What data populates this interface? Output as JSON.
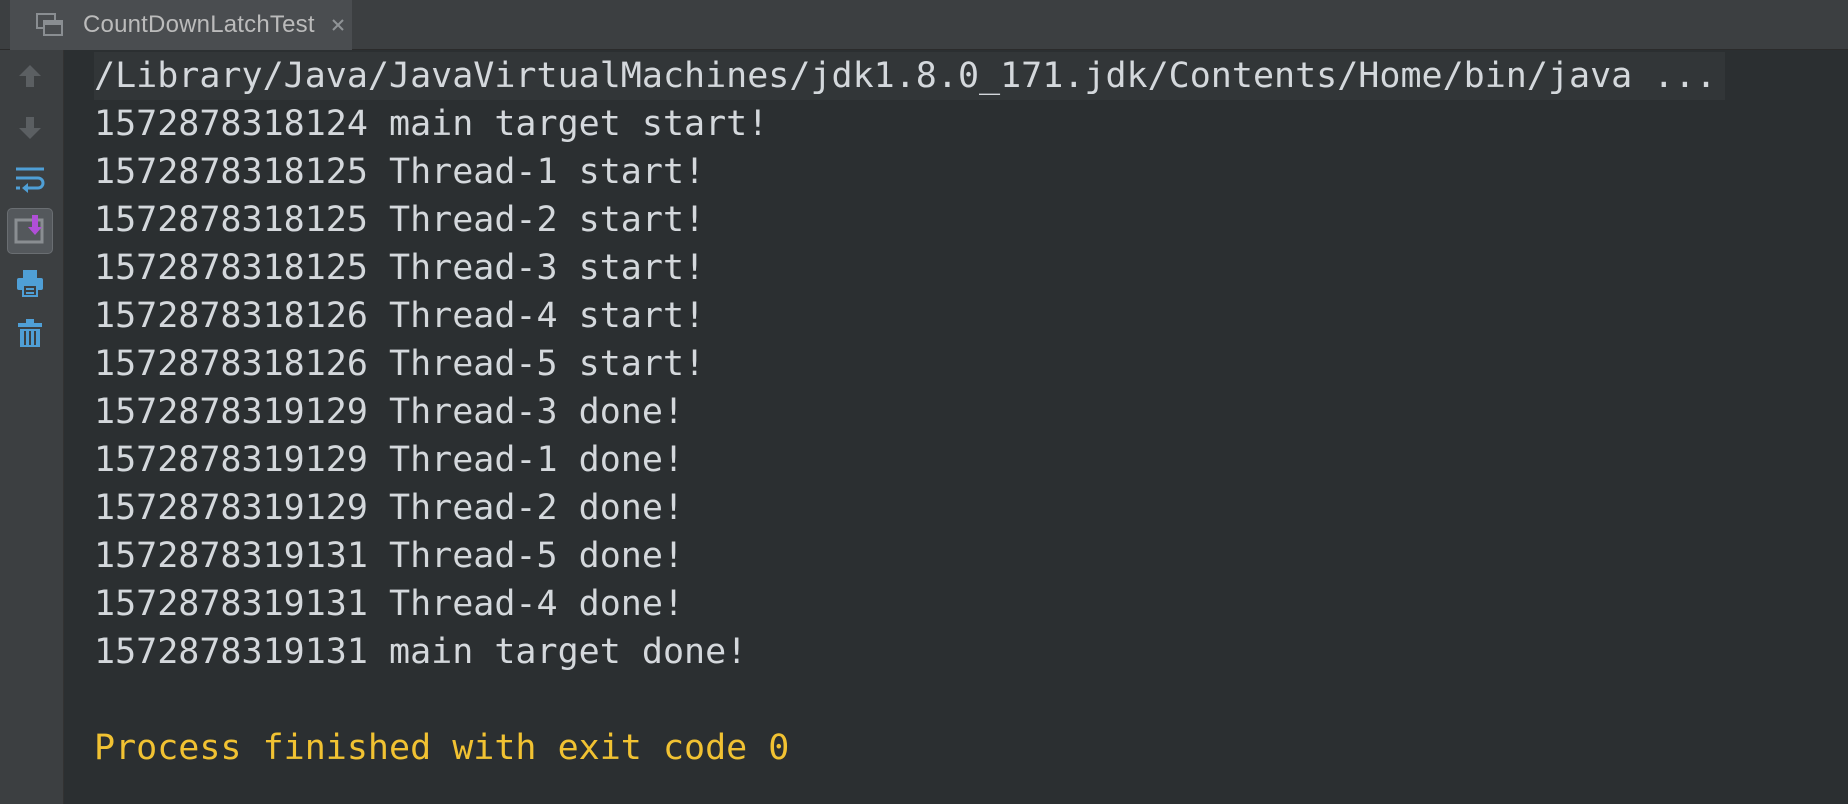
{
  "tab": {
    "title": "CountDownLatchTest",
    "icon": "console-window-icon",
    "close_icon": "close-icon"
  },
  "toolbar": {
    "items": [
      {
        "name": "scroll-up-arrow-icon"
      },
      {
        "name": "scroll-down-arrow-icon"
      },
      {
        "name": "soft-wrap-icon"
      },
      {
        "name": "scroll-to-end-icon",
        "active": true
      },
      {
        "name": "print-icon"
      },
      {
        "name": "clear-all-trash-icon"
      }
    ]
  },
  "console": {
    "command": "/Library/Java/JavaVirtualMachines/jdk1.8.0_171.jdk/Contents/Home/bin/java ...",
    "lines": [
      "1572878318124 main target start!",
      "1572878318125 Thread-1 start!",
      "1572878318125 Thread-2 start!",
      "1572878318125 Thread-3 start!",
      "1572878318126 Thread-4 start!",
      "1572878318126 Thread-5 start!",
      "1572878319129 Thread-3 done!",
      "1572878319129 Thread-1 done!",
      "1572878319129 Thread-2 done!",
      "1572878319131 Thread-5 done!",
      "1572878319131 Thread-4 done!",
      "1572878319131 main target done!"
    ],
    "exit_message": "Process finished with exit code 0"
  },
  "colors": {
    "background": "#2b2f31",
    "text": "#d4d8dc",
    "exit_text": "#f1c232",
    "toolbar_bg": "#3c3f41",
    "accent_icon": "#4f9fd6"
  }
}
